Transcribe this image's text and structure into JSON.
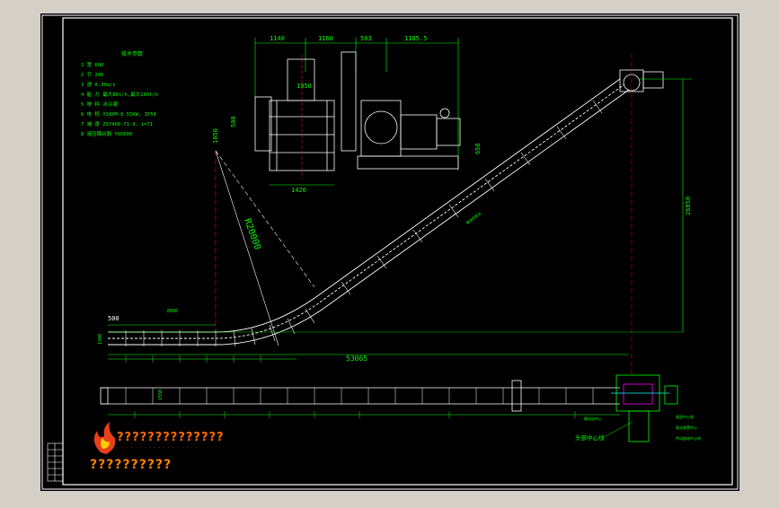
{
  "drawing": {
    "spec_title": "技术参数",
    "specs": [
      "1 宽 600",
      "2 节 200",
      "3 速 0.30m/s",
      "4 能 力 最大80t/h,最大100t/h",
      "5 物 料 冰冷凝",
      "6 电 机 Y280M-6 55KW, IP54",
      "7 减 速 ZSY400-71-Ⅱ, i=71",
      "8 液压耦合器 YOX600"
    ],
    "dims_top": [
      "1140",
      "1160",
      "503",
      "1185.5"
    ],
    "dim_1950": "1950",
    "dim_500": "500",
    "dim_1050": "1050",
    "dim_1420": "1420",
    "dim_658": "658",
    "dim_26850": "26850",
    "dim_radius": "R20000",
    "dim_500_bottom": "500",
    "dim_8000": "8000",
    "dim_1300": "1300",
    "dim_53065": "53065",
    "dim_1550": "1550",
    "label_center": "头部中心线",
    "label_side_1": "输送机中心",
    "label_side_2": "尾部中心线",
    "label_side_3": "驱动装置中心",
    "label_side_4": "传动链轮中心线",
    "slope_label": "输送机斜长"
  },
  "logo": {
    "text": "??????????????",
    "sub": "· · · · · · · · · · · · · · · · · ·"
  },
  "company": "??????????",
  "colors": {
    "bg": "#000000",
    "frame": "#ffffff",
    "dim": "#00ff00",
    "structure": "#ffffff",
    "spec": "#ffff00",
    "accent": "#ff00ff",
    "cyan": "#00ffff",
    "red": "#ff0000",
    "logo": "#ff6a00"
  }
}
